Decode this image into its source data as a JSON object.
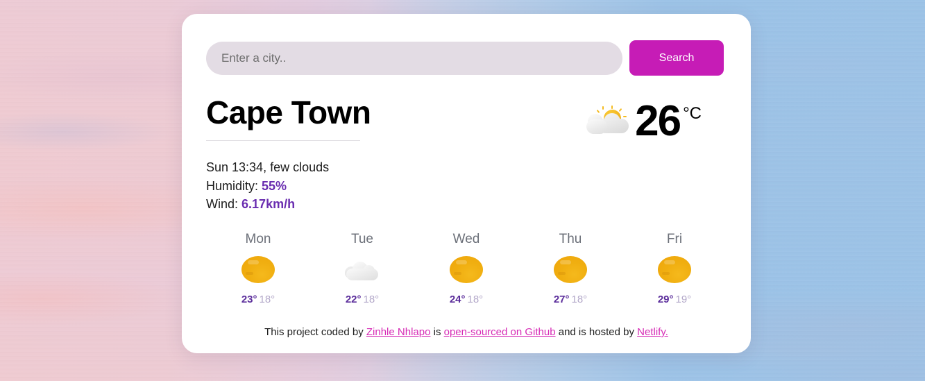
{
  "background": {
    "description": "pastel sunset sky photograph",
    "left_tone": "#e4bcc4",
    "right_tone": "#a3c6e4"
  },
  "search": {
    "placeholder": "Enter a city..",
    "value": "",
    "button_label": "Search",
    "button_color": "#c61cb6",
    "input_background": "#e3dce4"
  },
  "current": {
    "city": "Cape Town",
    "temperature": "26",
    "unit": "°C",
    "icon": "few-clouds-icon",
    "datetime_condition": "Sun 13:34, few clouds",
    "humidity_label": "Humidity:",
    "humidity_value": "55%",
    "wind_label": "Wind:",
    "wind_value": "6.17km/h",
    "accent_color": "#6a2db0"
  },
  "forecast": {
    "days": [
      {
        "day": "Mon",
        "icon": "clear-sky-icon",
        "max": "23°",
        "min": "18°"
      },
      {
        "day": "Tue",
        "icon": "clouds-icon",
        "max": "22°",
        "min": "18°"
      },
      {
        "day": "Wed",
        "icon": "clear-sky-icon",
        "max": "24°",
        "min": "18°"
      },
      {
        "day": "Thu",
        "icon": "clear-sky-icon",
        "max": "27°",
        "min": "18°"
      },
      {
        "day": "Fri",
        "icon": "clear-sky-icon",
        "max": "29°",
        "min": "19°"
      }
    ]
  },
  "footer": {
    "part1": "This project coded by ",
    "link_author": "Zinhle Nhlapo",
    "part2": " is ",
    "link_source": "open-sourced on Github",
    "part3": " and is hosted by ",
    "link_host": "Netlify.",
    "link_color": "#d62ab5"
  }
}
